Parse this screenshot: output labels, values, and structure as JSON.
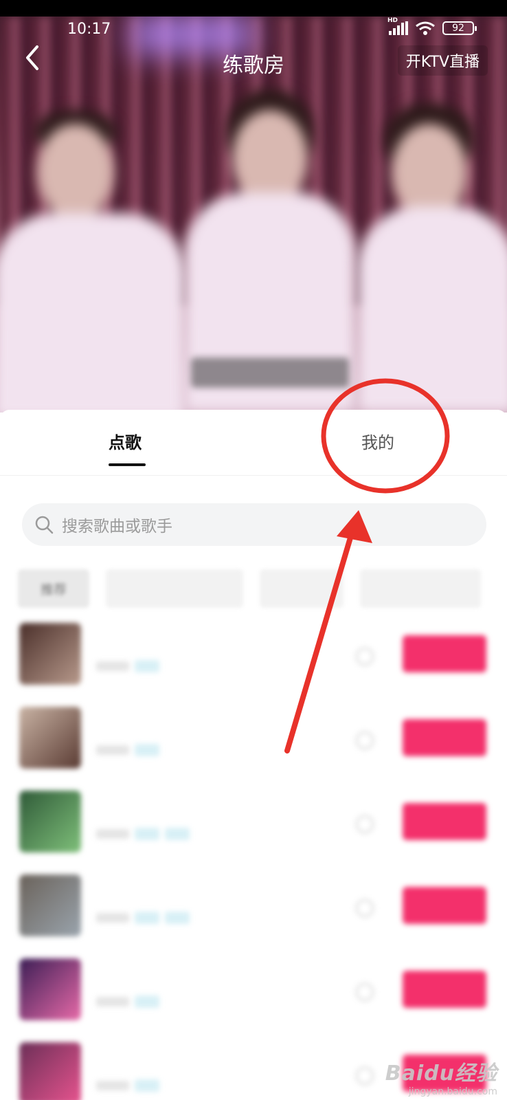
{
  "status_bar": {
    "time": "10:17",
    "network": "HD",
    "battery": "92"
  },
  "header": {
    "title": "练歌房",
    "ktv_button": "开KTV直播"
  },
  "tabs": [
    {
      "label": "点歌",
      "active": true
    },
    {
      "label": "我的",
      "active": false
    }
  ],
  "search": {
    "placeholder": "搜索歌曲或歌手"
  },
  "chips": [
    "推荐",
    "",
    "",
    ""
  ],
  "songs": [
    {
      "title": "",
      "cover": "#4a2f2a",
      "cover2": "#b89a8c",
      "tags": 1,
      "button": ""
    },
    {
      "title": "",
      "cover": "#c9b3a4",
      "cover2": "#5a3b33",
      "tags": 1,
      "button": ""
    },
    {
      "title": "",
      "cover": "#2f5a38",
      "cover2": "#7fc07a",
      "tags": 2,
      "button": ""
    },
    {
      "title": "",
      "cover": "#6a625a",
      "cover2": "#9aa4ad",
      "tags": 2,
      "button": ""
    },
    {
      "title": "",
      "cover": "#3b1e55",
      "cover2": "#e76aa8",
      "tags": 1,
      "button": ""
    },
    {
      "title": "",
      "cover": "#6b2f57",
      "cover2": "#e8548f",
      "tags": 1,
      "button": ""
    }
  ],
  "colors": {
    "accent": "#f3306b",
    "annotation": "#e8322a"
  },
  "watermark": {
    "brand": "Baidu经验",
    "url": "jingyan.baidu.com"
  }
}
